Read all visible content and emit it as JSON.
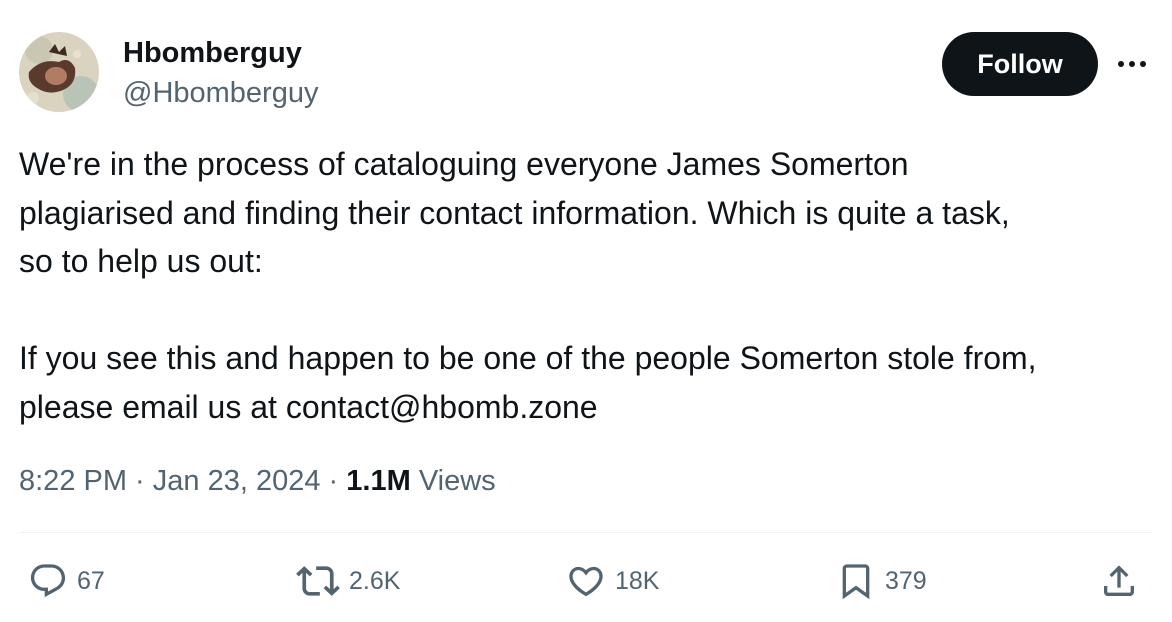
{
  "author": {
    "display_name": "Hbomberguy",
    "handle": "@Hbomberguy",
    "avatar_icon": "profile-photo"
  },
  "header": {
    "follow_label": "Follow",
    "more_icon": "more-horizontal-icon"
  },
  "tweet": {
    "text": "We're in the process of cataloguing everyone James Somerton\nplagiarised and finding their contact information. Which is quite a task,\nso to help us out:\n\nIf you see this and happen to be one of the people Somerton stole from,\nplease email us at contact@hbomb.zone"
  },
  "meta": {
    "time": "8:22 PM",
    "separator": " · ",
    "date": "Jan 23, 2024",
    "views_count": "1.1M",
    "views_label": "Views"
  },
  "actions": {
    "replies": {
      "icon": "reply-icon",
      "count": "67"
    },
    "retweets": {
      "icon": "retweet-icon",
      "count": "2.6K"
    },
    "likes": {
      "icon": "heart-icon",
      "count": "18K"
    },
    "bookmarks": {
      "icon": "bookmark-icon",
      "count": "379"
    },
    "share": {
      "icon": "share-icon"
    }
  },
  "colors": {
    "text_primary": "#0f1419",
    "text_secondary": "#536471",
    "follow_bg": "#0f1419",
    "divider": "#eff3f4"
  }
}
